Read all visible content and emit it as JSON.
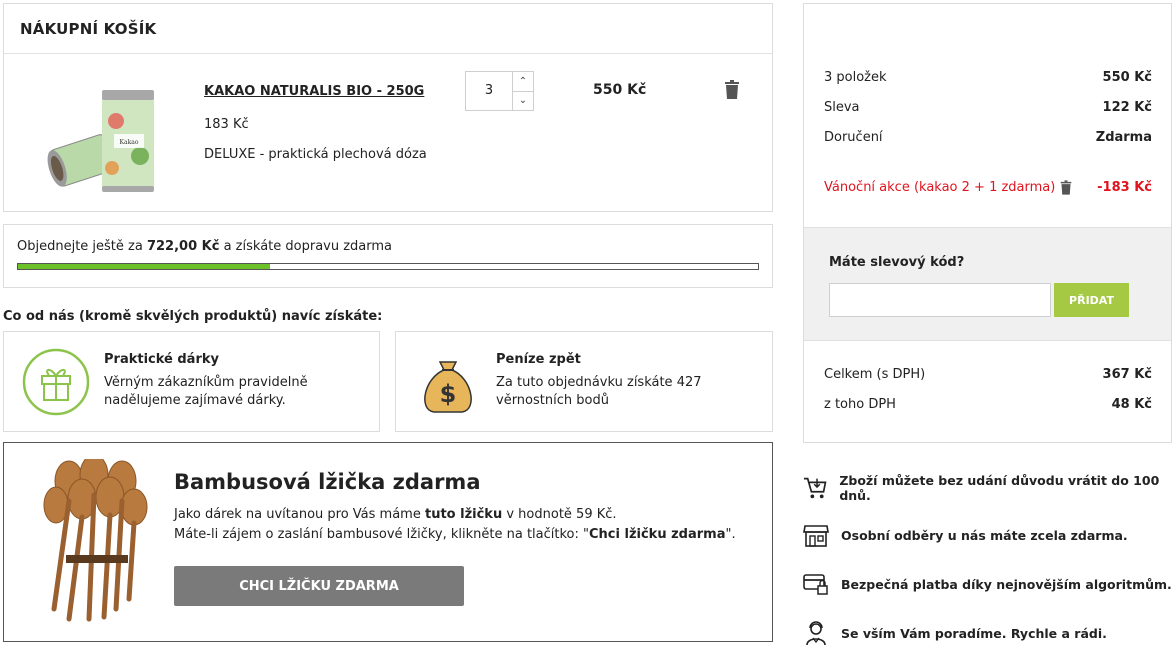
{
  "cart": {
    "title": "NÁKUPNÍ KOŠÍK",
    "item": {
      "name": "KAKAO NATURALIS BIO - 250G",
      "unit_price": "183 Kč",
      "variant": "DELUXE - praktická plechová dóza",
      "quantity": "3",
      "total": "550 Kč"
    }
  },
  "shipping": {
    "prefix": "Objednejte ještě za ",
    "amount": "722,00 Kč",
    "suffix": " a získáte dopravu zdarma",
    "progress_fraction": 0.34
  },
  "benefits": {
    "title": "Co od nás (kromě skvělých produktů) navíc získáte:",
    "gift": {
      "title": "Praktické dárky",
      "text": "Věrným zákazníkům pravidelně nadělujeme zajímavé dárky.",
      "icon": "gift-icon"
    },
    "money": {
      "title": "Peníze zpět",
      "text": "Za tuto objednávku získáte 427 věrnostních bodů",
      "icon": "money-bag-icon"
    }
  },
  "spoon_promo": {
    "title": "Bambusová lžička zdarma",
    "line1_a": "Jako dárek na uvítanou pro Vás máme ",
    "line1_b": "tuto lžičku",
    "line1_c": " v hodnotě 59 Kč.",
    "line2_a": "Máte-li zájem o zaslání bambusové lžičky, klikněte na tlačítko: \"",
    "line2_b": "Chci lžičku zdarma",
    "line2_c": "\".",
    "button": "CHCI LŽIČKU ZDARMA"
  },
  "summary": {
    "items_label": "3 položek",
    "items_value": "550 Kč",
    "discount_label": "Sleva",
    "discount_value": "122 Kč",
    "delivery_label": "Doručení",
    "delivery_value": "Zdarma",
    "promo_label": "Vánoční akce (kakao 2 + 1 zdarma)",
    "promo_value": "-183 Kč",
    "coupon_label": "Máte slevový kód?",
    "coupon_placeholder": "",
    "coupon_button": "PŘIDAT",
    "total_label": "Celkem (s DPH)",
    "total_value": "367 Kč",
    "vat_label": "z toho DPH",
    "vat_value": "48 Kč"
  },
  "guarantees": [
    {
      "text": "Zboží můžete bez udání důvodu vrátit do 100 dnů.",
      "icon": "cart-return-icon"
    },
    {
      "text": "Osobní odběry u nás máte zcela zdarma.",
      "icon": "store-icon"
    },
    {
      "text": "Bezpečná platba díky nejnovějším algoritmům.",
      "icon": "secure-payment-icon"
    },
    {
      "text": "Se vším Vám poradíme. Rychle a rádi.",
      "icon": "support-agent-icon"
    }
  ],
  "colors": {
    "progress_green": "#6cc12a",
    "accent_green": "#a5c943",
    "promo_red": "#e0141e",
    "button_gray": "#7a7a7a"
  }
}
